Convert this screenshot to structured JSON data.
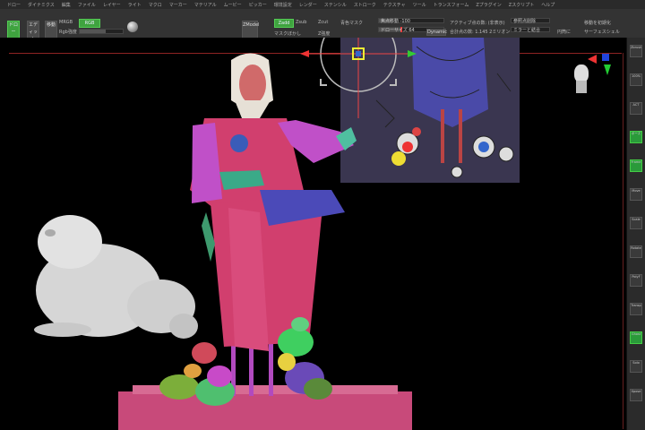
{
  "menu": [
    "ドロー",
    "ダイナミクス",
    "編集",
    "ファイル",
    "レイヤー",
    "ライト",
    "マクロ",
    "マーカー",
    "マテリアル",
    "ムービー",
    "ピッカー",
    "環境設定",
    "レンダー",
    "ステンシル",
    "ストローク",
    "テクスチャ",
    "ツール",
    "トランスフォーム",
    "Zプラグイン",
    "Zスクリプト",
    "ヘルプ"
  ],
  "toolbar": {
    "draw_label": "ドロー",
    "edit_label": "エディット",
    "move_label": "移動",
    "mrgb_label": "MRGB",
    "rgb_label": "RGB",
    "intensity_label": "Rgb強度",
    "zmodeler_label": "ZModel",
    "zadd_label": "Zadd",
    "zsub_label": "Zsub",
    "zcut_label": "Zcut",
    "focal_label": "焦点移動",
    "focal_value": "-100",
    "draw_size_label": "ドローサイズ",
    "draw_size_value": "64",
    "dynamic_label": "Dynamic",
    "zintensity_label": "Z強度",
    "mask_label": "マスクぼかし",
    "mask_top_label": "青色マスク",
    "active_points_label": "アクティブ点の数: (非表示)",
    "total_points_label": "合計点の数: 1.145 2ミリオン",
    "reset_label": "参照点削除",
    "move_reset_label": "移動を初期化",
    "merge_label": "ミラーと結合",
    "only_label": "円筒に",
    "surface_label": "サーフェスシェル"
  },
  "right_bar": [
    "Zbrush",
    "100%",
    "ACT",
    "ポーズ",
    "Frame",
    "Move",
    "Scale",
    "Rotate",
    "PolyF",
    "Transp",
    "Ghost",
    "Solo",
    "Xpose"
  ],
  "colors": {
    "accent_green": "#3fa33f",
    "menu_bg": "#2a2a2a",
    "toolbar_bg": "#333333",
    "canvas_bg": "#000000",
    "pedestal": "#c84a7a",
    "dress": "#d13f6e",
    "sleeves": "#c050c8",
    "frog_white": "#d8d8d8",
    "ref_image_bg": "#3a3650"
  }
}
